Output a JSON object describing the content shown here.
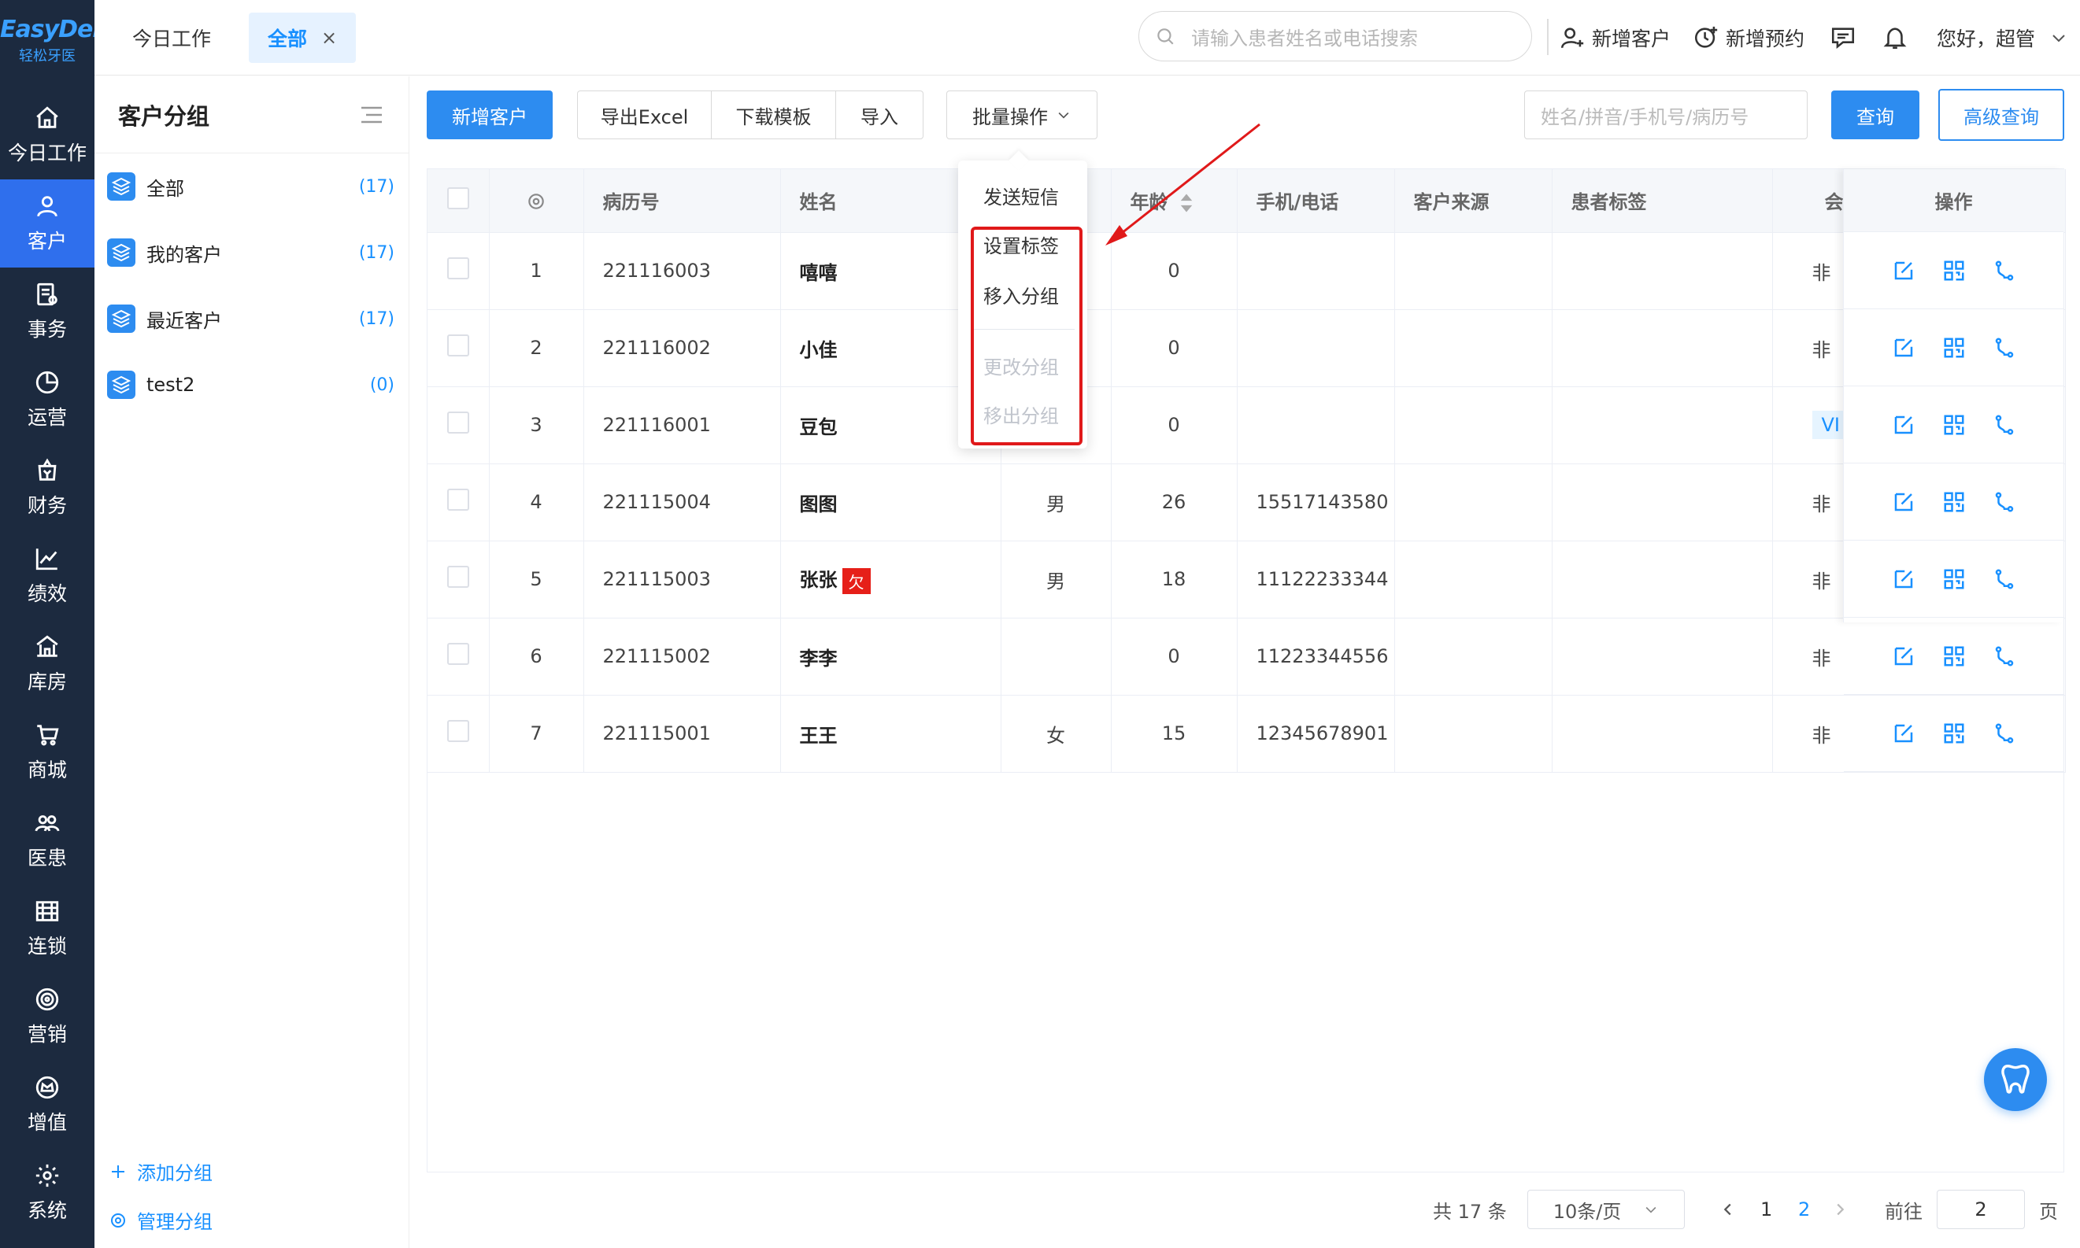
{
  "logo": {
    "main": "EasyDent",
    "sub": "轻松牙医"
  },
  "nav": [
    {
      "label": "今日工作",
      "icon": "home-icon"
    },
    {
      "label": "客户",
      "icon": "user-icon",
      "active": true
    },
    {
      "label": "事务",
      "icon": "task-icon"
    },
    {
      "label": "运营",
      "icon": "pie-chart-icon"
    },
    {
      "label": "财务",
      "icon": "finance-icon"
    },
    {
      "label": "绩效",
      "icon": "line-chart-icon"
    },
    {
      "label": "库房",
      "icon": "warehouse-icon"
    },
    {
      "label": "商城",
      "icon": "cart-icon"
    },
    {
      "label": "医患",
      "icon": "people-icon"
    },
    {
      "label": "连锁",
      "icon": "store-icon"
    },
    {
      "label": "营销",
      "icon": "target-icon"
    },
    {
      "label": "增值",
      "icon": "crown-icon"
    },
    {
      "label": "系统",
      "icon": "gear-icon"
    }
  ],
  "topbar": {
    "tab_today": "今日工作",
    "tab_all": "全部",
    "tab_close": "×",
    "search_placeholder": "请输入患者姓名或电话搜索",
    "new_customer": "新增客户",
    "new_appointment": "新增预约",
    "greeting": "您好，超管"
  },
  "groups": {
    "title": "客户分组",
    "items": [
      {
        "name": "全部",
        "count": "(17)"
      },
      {
        "name": "我的客户",
        "count": "(17)"
      },
      {
        "name": "最近客户",
        "count": "(17)"
      },
      {
        "name": "test2",
        "count": "(0)"
      }
    ],
    "add": "添加分组",
    "manage": "管理分组"
  },
  "toolbar": {
    "add_customer": "新增客户",
    "export_excel": "导出Excel",
    "download_template": "下载模板",
    "import": "导入",
    "batch": "批量操作",
    "filter_placeholder": "姓名/拼音/手机号/病历号",
    "query": "查询",
    "advanced_query": "高级查询"
  },
  "batch_menu": {
    "items": [
      "发送短信",
      "设置标签",
      "移入分组",
      "更改分组",
      "移出分组"
    ]
  },
  "table": {
    "headers": {
      "record_no": "病历号",
      "name": "姓名",
      "age": "年龄",
      "phone": "手机/电话",
      "source": "客户来源",
      "tags": "患者标签",
      "member": "会",
      "actions": "操作"
    },
    "rows": [
      {
        "idx": "1",
        "record": "221116003",
        "name": "嘻嘻",
        "owe": "",
        "gender": "",
        "age": "0",
        "phone": "",
        "member": "非",
        "vip": ""
      },
      {
        "idx": "2",
        "record": "221116002",
        "name": "小佳",
        "owe": "",
        "gender": "",
        "age": "0",
        "phone": "",
        "member": "非",
        "vip": ""
      },
      {
        "idx": "3",
        "record": "221116001",
        "name": "豆包",
        "owe": "",
        "gender": "",
        "age": "0",
        "phone": "",
        "member": "",
        "vip": "VI"
      },
      {
        "idx": "4",
        "record": "221115004",
        "name": "图图",
        "owe": "",
        "gender": "男",
        "age": "26",
        "phone": "15517143580",
        "member": "非",
        "vip": ""
      },
      {
        "idx": "5",
        "record": "221115003",
        "name": "张张",
        "owe": "欠",
        "gender": "男",
        "age": "18",
        "phone": "11122233344",
        "member": "非",
        "vip": ""
      },
      {
        "idx": "6",
        "record": "221115002",
        "name": "李李",
        "owe": "",
        "gender": "",
        "age": "0",
        "phone": "11223344556",
        "member": "非",
        "vip": ""
      },
      {
        "idx": "7",
        "record": "221115001",
        "name": "王王",
        "owe": "",
        "gender": "女",
        "age": "15",
        "phone": "12345678901",
        "member": "非",
        "vip": ""
      }
    ]
  },
  "pagination": {
    "total": "共 17 条",
    "page_size": "10条/页",
    "page1": "1",
    "page2": "2",
    "goto": "前往",
    "goto_value": "2",
    "page_suffix": "页"
  },
  "colors": {
    "accent": "#2d8cf0",
    "nav_bg": "#1c2a3f",
    "highlight": "#e0191a"
  }
}
